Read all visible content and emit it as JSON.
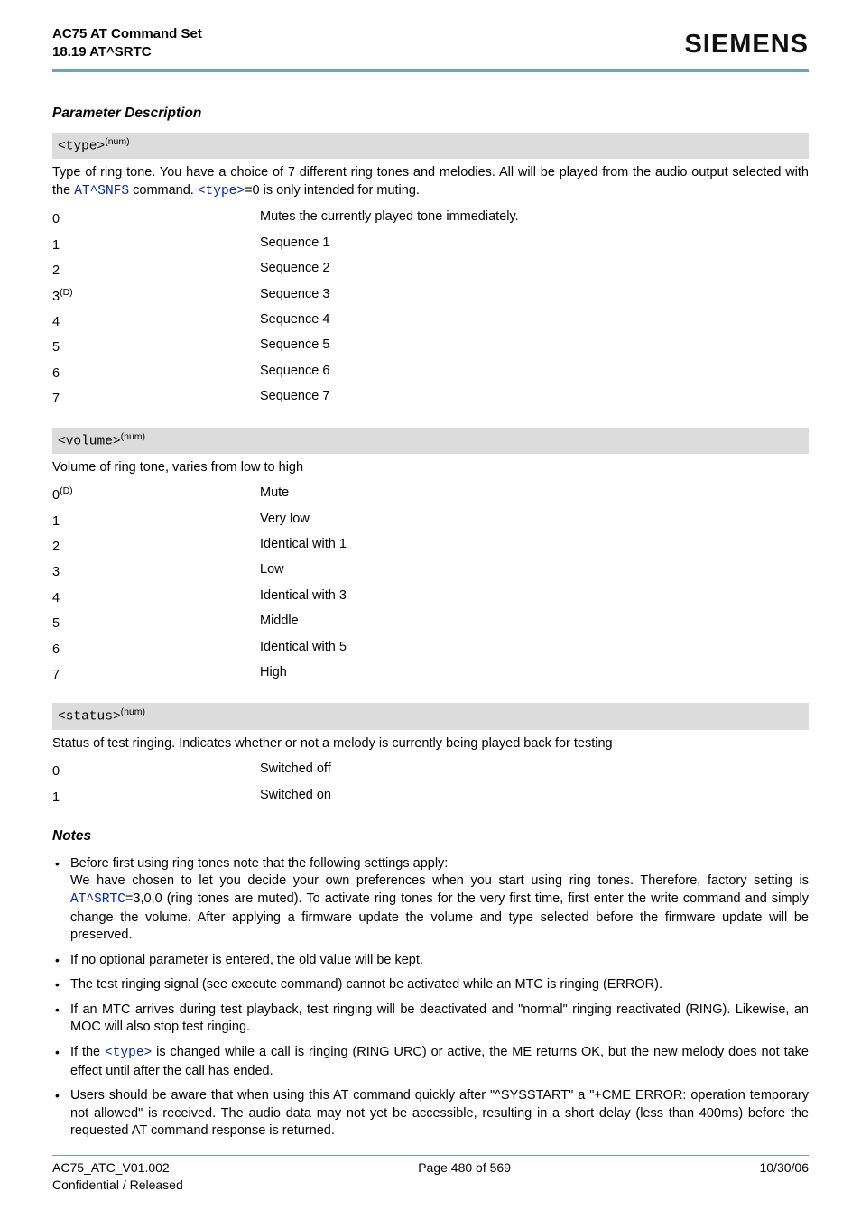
{
  "header": {
    "title_line1": "AC75 AT Command Set",
    "title_line2": "18.19 AT^SRTC",
    "brand": "SIEMENS"
  },
  "sections": {
    "param_desc_heading": "Parameter Description",
    "notes_heading": "Notes"
  },
  "params": {
    "type": {
      "bar_mono": "<type>",
      "bar_sup": "(num)",
      "desc_pre": "Type of ring tone. You have a choice of 7 different ring tones and melodies. All will be played from the audio output selected with the ",
      "desc_link1": "AT^SNFS",
      "desc_mid": " command. ",
      "desc_link2": "<type>",
      "desc_post": "=0 is only intended for muting.",
      "rows": [
        {
          "k": "0",
          "sup": "",
          "v": "Mutes the currently played tone immediately."
        },
        {
          "k": "1",
          "sup": "",
          "v": "Sequence 1"
        },
        {
          "k": "2",
          "sup": "",
          "v": "Sequence 2"
        },
        {
          "k": "3",
          "sup": "(D)",
          "v": "Sequence 3"
        },
        {
          "k": "4",
          "sup": "",
          "v": "Sequence 4"
        },
        {
          "k": "5",
          "sup": "",
          "v": "Sequence 5"
        },
        {
          "k": "6",
          "sup": "",
          "v": "Sequence 6"
        },
        {
          "k": "7",
          "sup": "",
          "v": "Sequence 7"
        }
      ]
    },
    "volume": {
      "bar_mono": "<volume>",
      "bar_sup": "(num)",
      "desc": "Volume of ring tone, varies from low to high",
      "rows": [
        {
          "k": "0",
          "sup": "(D)",
          "v": "Mute"
        },
        {
          "k": "1",
          "sup": "",
          "v": "Very low"
        },
        {
          "k": "2",
          "sup": "",
          "v": "Identical with 1"
        },
        {
          "k": "3",
          "sup": "",
          "v": "Low"
        },
        {
          "k": "4",
          "sup": "",
          "v": "Identical with 3"
        },
        {
          "k": "5",
          "sup": "",
          "v": "Middle"
        },
        {
          "k": "6",
          "sup": "",
          "v": "Identical with 5"
        },
        {
          "k": "7",
          "sup": "",
          "v": "High"
        }
      ]
    },
    "status": {
      "bar_mono": "<status>",
      "bar_sup": "(num)",
      "desc": "Status of test ringing. Indicates whether or not a melody is currently being played back for testing",
      "rows": [
        {
          "k": "0",
          "sup": "",
          "v": "Switched off"
        },
        {
          "k": "1",
          "sup": "",
          "v": "Switched on"
        }
      ]
    }
  },
  "notes": {
    "n1_line1": "Before first using ring tones note that the following settings apply:",
    "n1_line2_pre": "We have chosen to let you decide your own preferences when you start using ring tones. Therefore, factory setting is ",
    "n1_link": "AT^SRTC",
    "n1_line2_post": "=3,0,0 (ring tones are muted). To activate ring tones for the very first time, first enter the write command and simply change the volume. After applying a firmware update the volume and type selected before the firmware update will be preserved.",
    "n2": "If no optional parameter is entered, the old value will be kept.",
    "n3": "The test ringing signal (see execute command) cannot be activated while an MTC is ringing (ERROR).",
    "n4": "If an MTC arrives during test playback, test ringing will be deactivated and \"normal\" ringing reactivated (RING). Likewise, an MOC will also stop test ringing.",
    "n5_pre": "If the ",
    "n5_link": "<type>",
    "n5_post": " is changed while a call is ringing (RING URC) or active, the ME returns OK, but the new melody does not take effect until after the call has ended.",
    "n6": "Users should be aware that when using this AT command quickly after \"^SYSSTART\" a \"+CME ERROR: operation temporary not allowed\" is received. The audio data may not yet be accessible, resulting in a short delay (less than 400ms) before the requested AT command response is returned."
  },
  "footer": {
    "left1": "AC75_ATC_V01.002",
    "center": "Page 480 of 569",
    "right": "10/30/06",
    "left2": "Confidential / Released"
  }
}
